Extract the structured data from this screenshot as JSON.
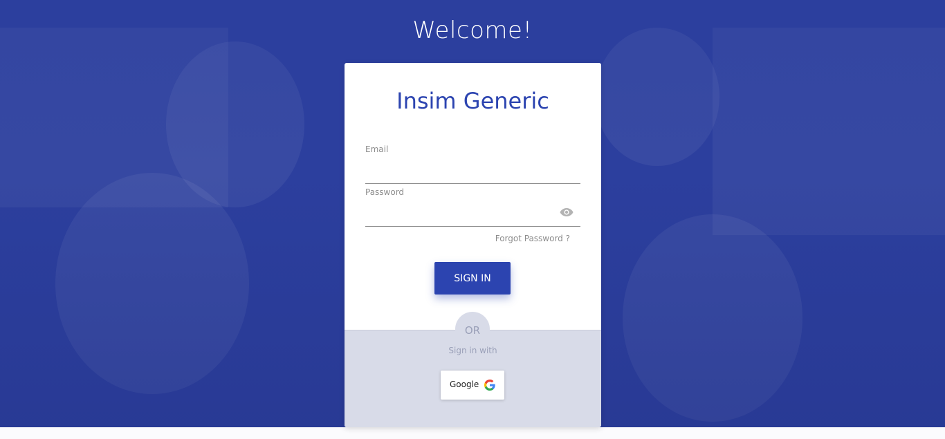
{
  "page": {
    "welcome": "Welcome!",
    "app_name": "Insim Generic"
  },
  "form": {
    "email_label": "Email",
    "email_value": "",
    "password_label": "Password",
    "password_value": "",
    "forgot_password": "Forgot Password ?",
    "signin_button": "SIGN IN"
  },
  "social": {
    "or_text": "OR",
    "sign_in_with": "Sign in with",
    "google_label": "Google"
  },
  "icons": {
    "password_toggle": "eye-icon",
    "google": "google-g-icon"
  },
  "colors": {
    "background_overlay": "#2c3f9e",
    "brand": "#2c44b0",
    "bottom_panel": "#d8dbe8"
  }
}
